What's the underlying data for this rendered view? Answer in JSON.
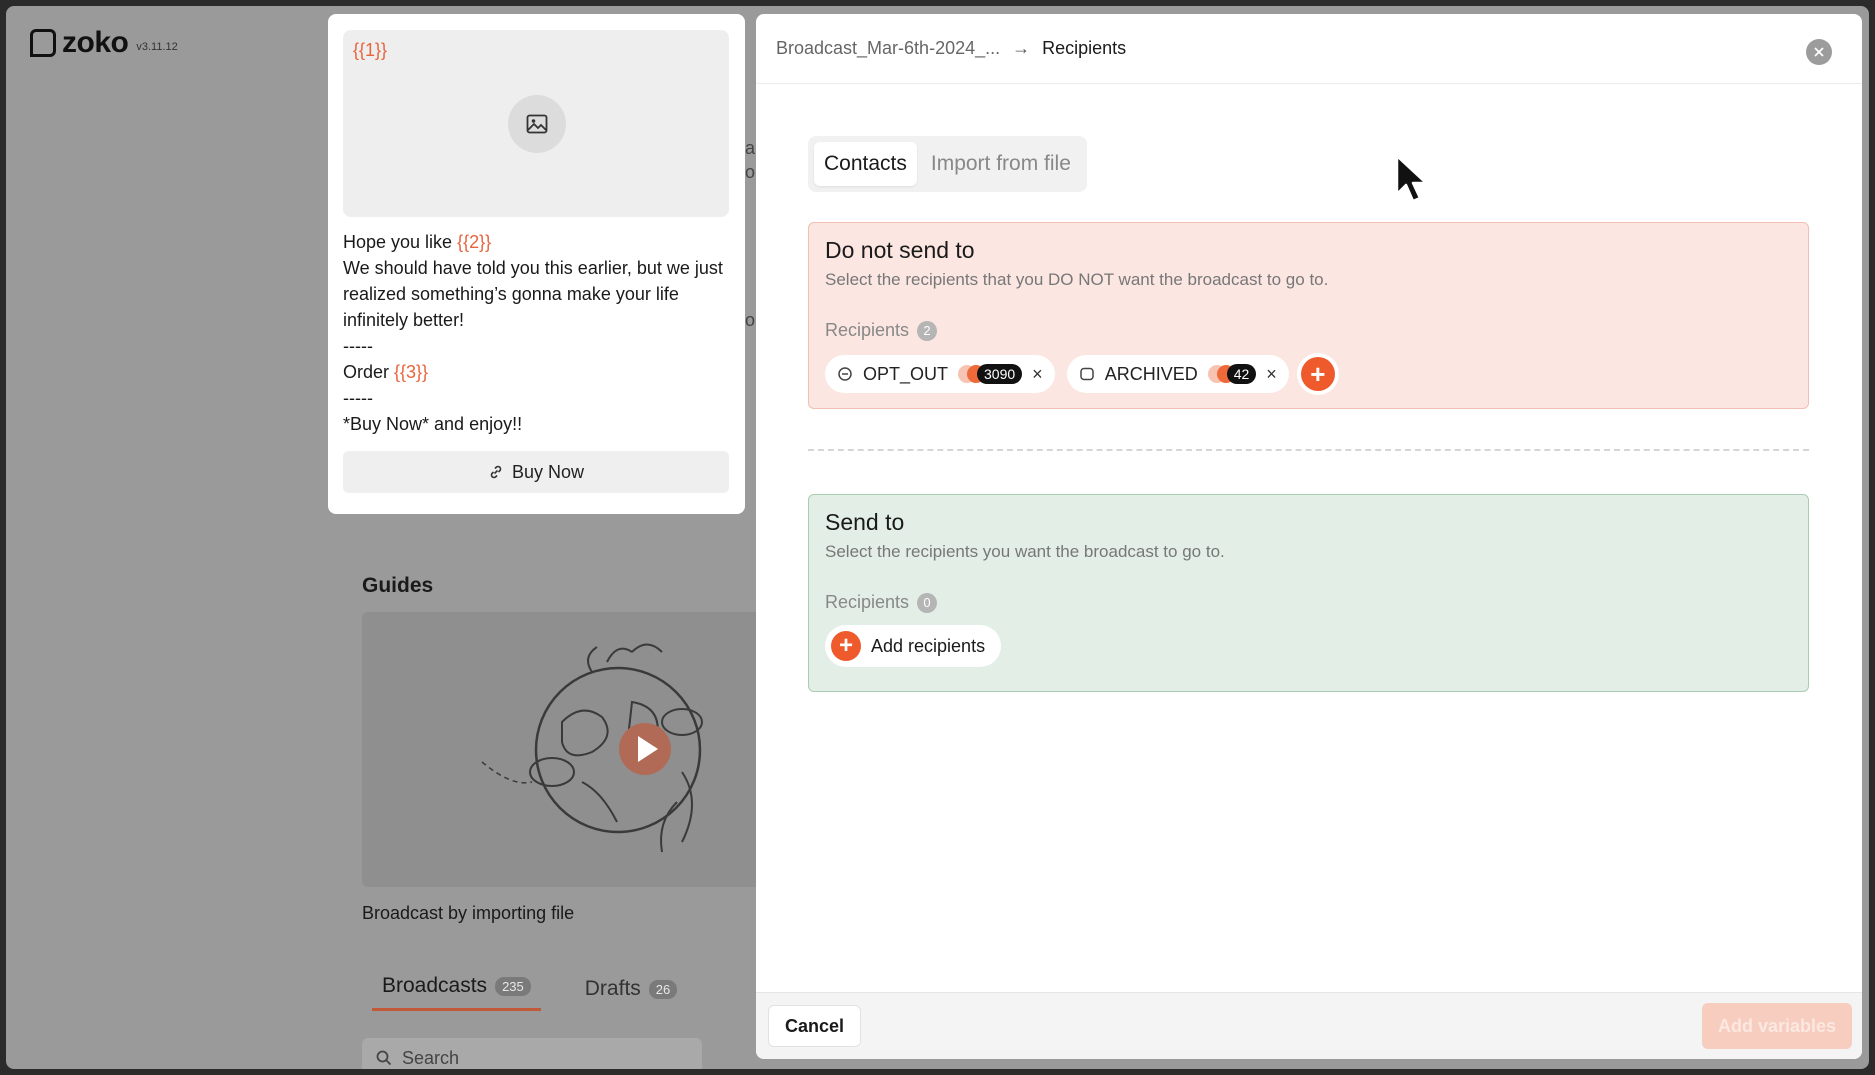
{
  "app": {
    "name": "zoko",
    "version": "v3.11.12"
  },
  "preview": {
    "media_var": "{{1}}",
    "body": [
      {
        "text": "Hope you like ",
        "var": "{{2}}"
      },
      {
        "text": "We should have told you this earlier, but we just realized something’s gonna make your life infinitely better!"
      },
      {
        "text": "-----"
      },
      {
        "text": "Order ",
        "var": "{{3}}"
      },
      {
        "text": "-----"
      },
      {
        "text": "*Buy Now* and enjoy!!"
      }
    ],
    "button_label": "Buy Now"
  },
  "background": {
    "guides_title": "Guides",
    "guide_caption": "Broadcast by importing file",
    "tabs": [
      {
        "label": "Broadcasts",
        "count": "235"
      },
      {
        "label": "Drafts",
        "count": "26"
      }
    ],
    "search_placeholder": "Search"
  },
  "panel": {
    "breadcrumb": {
      "parent": "Broadcast_Mar-6th-2024_...",
      "arrow": "→",
      "current": "Recipients"
    },
    "tabs": [
      {
        "label": "Contacts",
        "active": true
      },
      {
        "label": "Import from file",
        "active": false
      }
    ],
    "do_not_send": {
      "title": "Do not send to",
      "subtitle": "Select the recipients that you DO NOT want the broadcast to go to.",
      "recipients_label": "Recipients",
      "recipients_count": "2",
      "chips": [
        {
          "label": "OPT_OUT",
          "count": "3090",
          "icon": "opt-out-icon"
        },
        {
          "label": "ARCHIVED",
          "count": "42",
          "icon": "archive-icon"
        }
      ]
    },
    "send_to": {
      "title": "Send to",
      "subtitle": "Select the recipients you want the broadcast to go to.",
      "recipients_label": "Recipients",
      "recipients_count": "0",
      "add_label": "Add recipients"
    },
    "footer": {
      "cancel_label": "Cancel",
      "add_variables_label": "Add variables"
    }
  },
  "colors": {
    "accent": "#ef5a2c",
    "exclude_bg": "#fbe6e1",
    "include_bg": "#e3efe6"
  }
}
